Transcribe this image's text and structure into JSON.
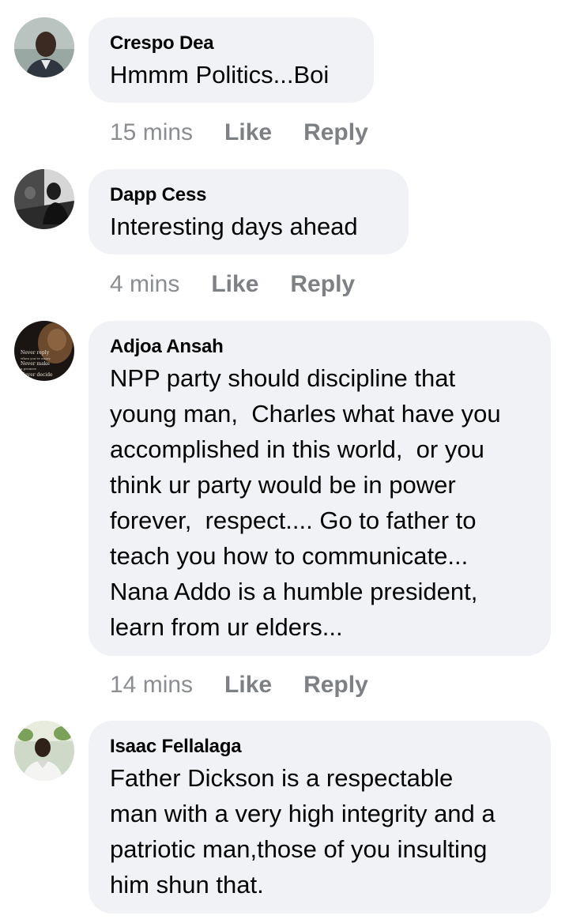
{
  "comments": [
    {
      "author": "Crespo Dea",
      "text": "Hmmm Politics...Boi",
      "time": "15 mins",
      "like_label": "Like",
      "reply_label": "Reply"
    },
    {
      "author": "Dapp Cess",
      "text": "Interesting days ahead",
      "time": "4 mins",
      "like_label": "Like",
      "reply_label": "Reply"
    },
    {
      "author": "Adjoa Ansah",
      "text": "NPP party should discipline that\nyoung man,  Charles what have you\naccomplished in this world,  or you\nthink ur party would be in power\nforever,  respect.... Go to father to\nteach you how to communicate...\nNana Addo is a humble president,\nlearn from ur elders...",
      "time": "14 mins",
      "like_label": "Like",
      "reply_label": "Reply"
    },
    {
      "author": "Isaac Fellalaga",
      "text": "Father Dickson is a respectable\nman with a very high integrity and a\npatriotic man,those of you insulting\nhim shun that."
    }
  ],
  "avatar_images": {
    "comment_3_overlay_text": "Never reply when you're angry. Never make a promise when you're happy. Never decide..."
  },
  "colors": {
    "bubble_bg": "#f0f2f5",
    "action_text": "#65676b",
    "author_text": "#050505"
  }
}
